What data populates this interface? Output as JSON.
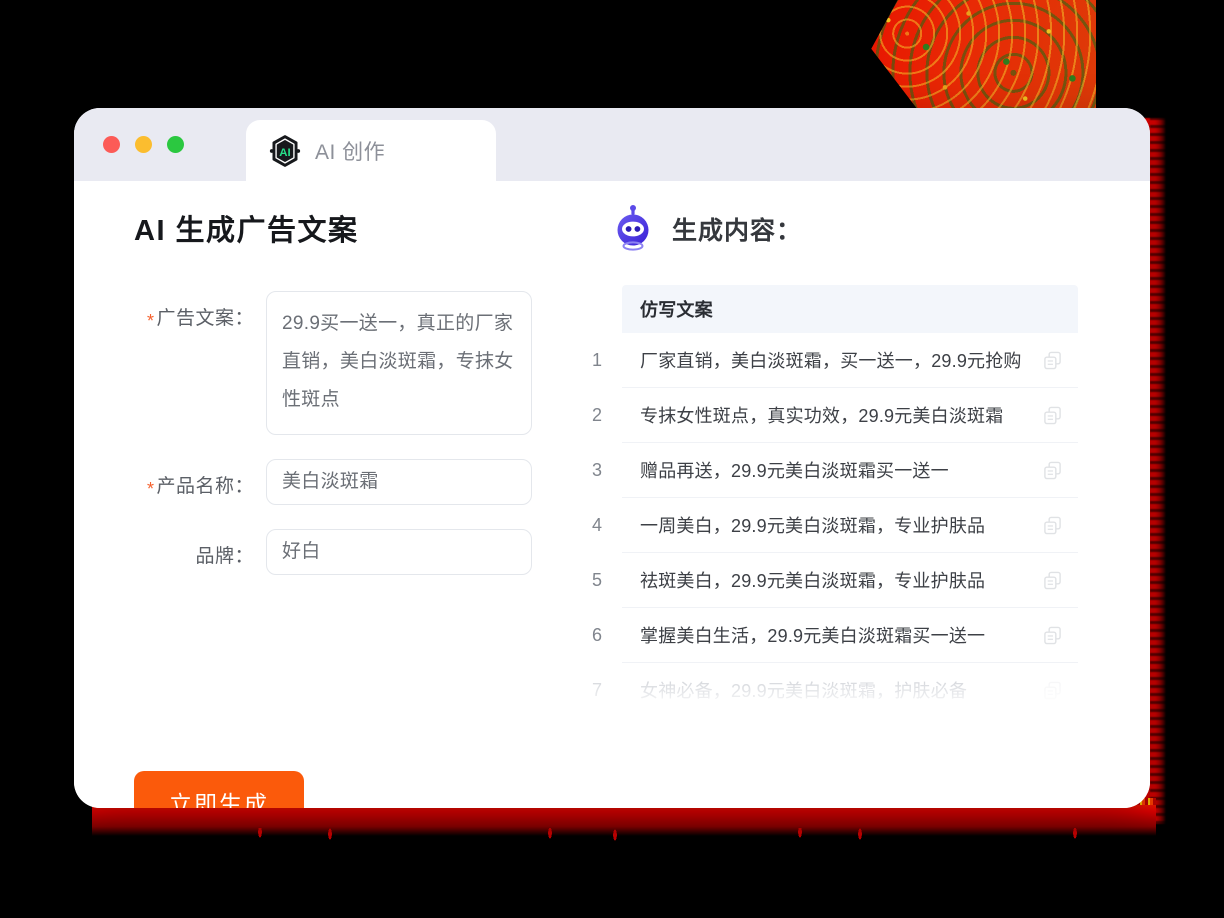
{
  "window": {
    "traffic_lights": [
      {
        "name": "close",
        "color": "#fc5b57"
      },
      {
        "name": "minimize",
        "color": "#fbbd2f"
      },
      {
        "name": "zoom",
        "color": "#2bc840"
      }
    ],
    "tab": {
      "icon": "ai-hexagon-icon",
      "icon_text": "AI",
      "label": "AI 创作"
    }
  },
  "left_panel": {
    "title": "AI 生成广告文案",
    "fields": [
      {
        "label": "广告文案：",
        "required": true,
        "type": "textarea",
        "value": "29.9买一送一，真正的厂家直销，美白淡斑霜，专抹女性斑点"
      },
      {
        "label": "产品名称：",
        "required": true,
        "type": "input",
        "value": "美白淡斑霜"
      },
      {
        "label": "品牌：",
        "required": false,
        "type": "input",
        "value": "好白"
      }
    ],
    "submit_button": {
      "label": "立即生成",
      "color": "#fb5a0b"
    }
  },
  "right_panel": {
    "icon": "robot-icon",
    "title": "生成内容：",
    "table": {
      "column_header": "仿写文案",
      "rows": [
        {
          "num": "1",
          "text": "厂家直销，美白淡斑霜，买一送一，29.9元抢购",
          "faded": false
        },
        {
          "num": "2",
          "text": "专抹女性斑点，真实功效，29.9元美白淡斑霜",
          "faded": false
        },
        {
          "num": "3",
          "text": "赠品再送，29.9元美白淡斑霜买一送一",
          "faded": false
        },
        {
          "num": "4",
          "text": "一周美白，29.9元美白淡斑霜，专业护肤品",
          "faded": false
        },
        {
          "num": "5",
          "text": "祛斑美白，29.9元美白淡斑霜，专业护肤品",
          "faded": false
        },
        {
          "num": "6",
          "text": "掌握美白生活，29.9元美白淡斑霜买一送一",
          "faded": false
        },
        {
          "num": "7",
          "text": "女神必备，29.9元美白淡斑霜，护肤必备",
          "faded": true
        }
      ],
      "row_action_icon": "copy-icon"
    }
  },
  "decoration": {
    "accent_red": "#e81400",
    "accent_orange": "#fb5a0b"
  }
}
